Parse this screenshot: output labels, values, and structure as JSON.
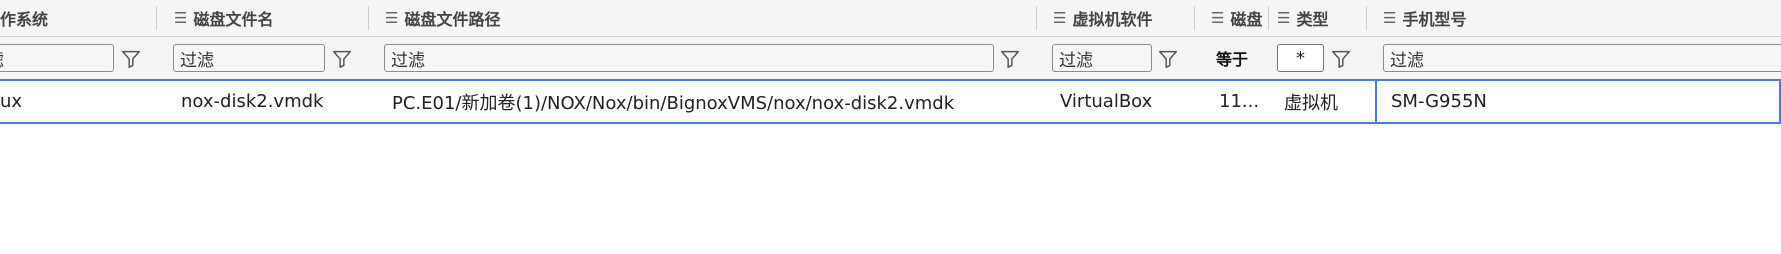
{
  "columns": [
    {
      "key": "os",
      "header": "作系统"
    },
    {
      "key": "disk_file_name",
      "header": "磁盘文件名"
    },
    {
      "key": "disk_file_path",
      "header": "磁盘文件路径"
    },
    {
      "key": "vm_software",
      "header": "虚拟机软件"
    },
    {
      "key": "disk_size",
      "header": "磁盘"
    },
    {
      "key": "type",
      "header": "类型"
    },
    {
      "key": "phone_model",
      "header": "手机型号"
    }
  ],
  "filters": {
    "os": "滤",
    "disk_file_name": "过滤",
    "disk_file_path": "过滤",
    "vm_software": "过滤",
    "disk_size_operator": "等于",
    "type_value": "*",
    "phone_model": "过滤"
  },
  "row": {
    "os": "ux",
    "disk_file_name": "nox-disk2.vmdk",
    "disk_file_path": "PC.E01/新加卷(1)/NOX/Nox/bin/BignoxVMS/nox/nox-disk2.vmdk",
    "vm_software": "VirtualBox",
    "disk_size": "11...",
    "type": "虚拟机",
    "phone_model": "SM-G955N"
  },
  "icons": {
    "column_icon": "list-icon",
    "filter_icon": "funnel-icon"
  },
  "colors": {
    "selection_border": "#4a78e6",
    "header_bg": "#f5f5f5"
  }
}
